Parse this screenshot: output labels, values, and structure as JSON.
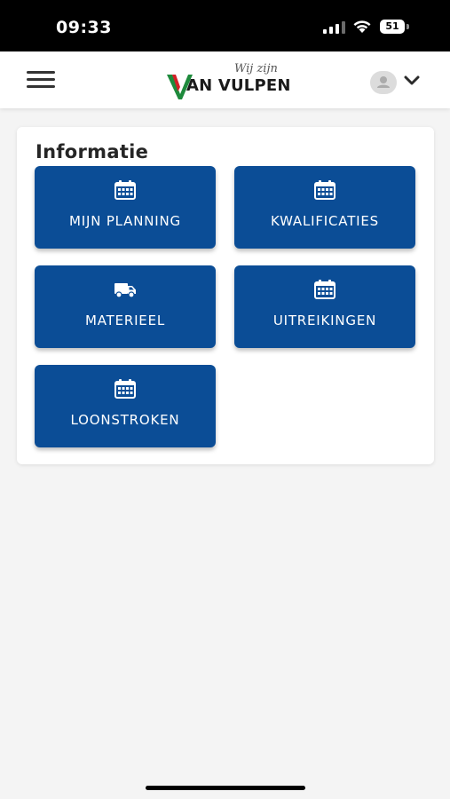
{
  "status_bar": {
    "time": "09:33",
    "battery": "51"
  },
  "header": {
    "logo_tagline": "Wij zijn",
    "logo_text": "AN VULPEN",
    "colors": {
      "logo_green": "#1e8a3c",
      "logo_red": "#d32027"
    }
  },
  "informatie": {
    "title": "Informatie",
    "tiles": [
      {
        "label": "MIJN PLANNING",
        "icon": "calendar-icon"
      },
      {
        "label": "KWALIFICATIES",
        "icon": "calendar-icon"
      },
      {
        "label": "MATERIEEL",
        "icon": "truck-icon"
      },
      {
        "label": "UITREIKINGEN",
        "icon": "calendar-icon"
      },
      {
        "label": "LOONSTROKEN",
        "icon": "calendar-icon"
      }
    ]
  },
  "colors": {
    "tile_background": "#0b4d96",
    "page_background": "#f4f4f4"
  }
}
